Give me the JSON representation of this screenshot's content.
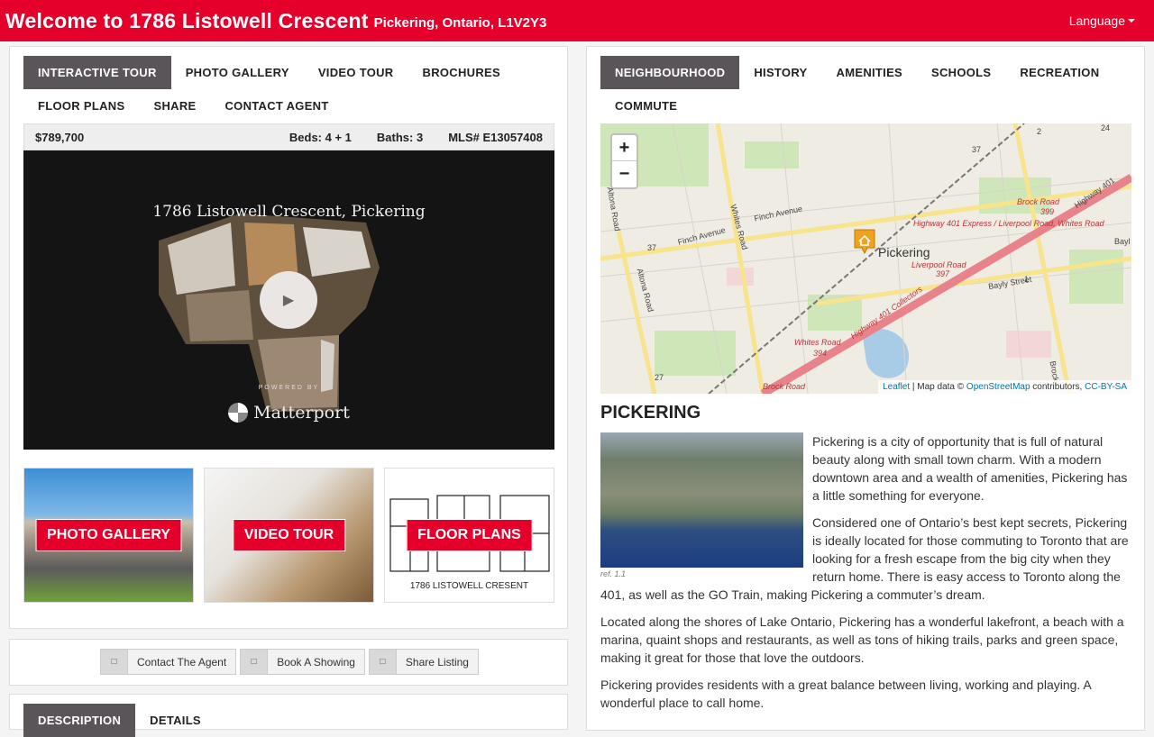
{
  "header": {
    "title": "Welcome to 1786 Listowell Crescent",
    "subtitle": "Pickering, Ontario, L1V2Y3",
    "language_label": "Language"
  },
  "left_tabs": [
    {
      "label": "INTERACTIVE TOUR",
      "active": true
    },
    {
      "label": "PHOTO GALLERY"
    },
    {
      "label": "VIDEO TOUR"
    },
    {
      "label": "BROCHURES"
    },
    {
      "label": "FLOOR PLANS"
    },
    {
      "label": "SHARE"
    },
    {
      "label": "CONTACT AGENT"
    }
  ],
  "listing": {
    "price": "$789,700",
    "beds": "Beds: 4 + 1",
    "baths": "Baths: 3",
    "mls": "MLS# E13057408"
  },
  "tour": {
    "title": "1786 Listowell Crescent, Pickering",
    "play_icon": "play-icon",
    "powered_by": "POWERED BY",
    "brand": "Matterport"
  },
  "thumbs": {
    "photo": "PHOTO GALLERY",
    "video": "VIDEO TOUR",
    "floor": "FLOOR PLANS",
    "floor_caption": "1786 LISTOWELL CRESENT"
  },
  "actions": [
    {
      "label": "Contact The Agent",
      "icon": "user-icon"
    },
    {
      "label": "Book A Showing",
      "icon": "calendar-icon"
    },
    {
      "label": "Share Listing",
      "icon": "share-icon"
    }
  ],
  "desc_tabs": [
    {
      "label": "DESCRIPTION",
      "active": true
    },
    {
      "label": "DETAILS"
    }
  ],
  "right_tabs": [
    {
      "label": "NEIGHBOURHOOD",
      "active": true
    },
    {
      "label": "HISTORY"
    },
    {
      "label": "AMENITIES"
    },
    {
      "label": "SCHOOLS"
    },
    {
      "label": "RECREATION"
    },
    {
      "label": "COMMUTE"
    }
  ],
  "map": {
    "zoom_in": "+",
    "zoom_out": "−",
    "city_label": "Pickering",
    "attribution_leaflet": "Leaflet",
    "attribution_mid": " | Map data © ",
    "attribution_osm": "OpenStreetMap",
    "attribution_contrib": " contributors, ",
    "attribution_license": "CC-BY-SA",
    "labels": {
      "finch": "Finch Avenue",
      "finch2": "Finch Avenue",
      "whites": "Whites Road",
      "altona": "Altona Road",
      "brock": "Brock Road",
      "brock_399": "399",
      "hwy401": "Highway 401 Express / Liverpool Road, Whites Road",
      "liverpool": "Liverpool Road",
      "liverpool_397": "397",
      "bayly": "Bayly Street",
      "whites_394": "Whites Road",
      "n394": "394",
      "hwy401c": "Highway 401 Collectors",
      "n37": "37",
      "n37b": "37",
      "n27": "27",
      "n1": "1",
      "n2": "2",
      "n24": "24",
      "hwy401_ne": "Highway 401",
      "brock_s": "Brock Road",
      "brock_e": "Brock",
      "bayly_e": "Bayl"
    }
  },
  "city": {
    "heading": "PICKERING",
    "image_ref": "ref. 1.1",
    "paragraphs": [
      "Pickering is a city of opportunity that is full of natural beauty along with small town charm. With a modern downtown area and a wealth of amenities, Pickering has a little something for everyone.",
      "Considered one of Ontario’s best kept secrets, Pickering is ideally located for those commuting to Toronto that are looking for a fresh escape from the big city when they return home. There is easy access to Toronto along the 401, as well as the GO Train, making Pickering a commuter’s dream.",
      "Located along the shores of Lake Ontario, Pickering has a wonderful lakefront, a beach with a marina, quaint shops and restaurants, as well as tons of hiking trails, parks and green space, making it great for those that love the outdoors.",
      "Pickering provides residents with a great balance between living, working and playing. A wonderful place to call home."
    ]
  },
  "colors": {
    "brand_red": "#e4002b",
    "tab_active": "#5a5558"
  }
}
